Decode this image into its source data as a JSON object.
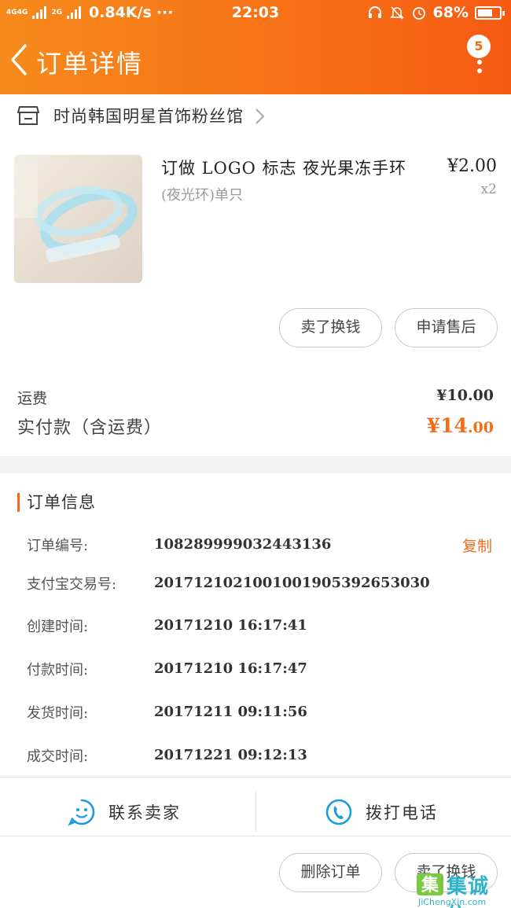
{
  "status_bar": {
    "network_1": "4G",
    "network_2": "4G",
    "network_3": "2G",
    "speed": "0.84K/s",
    "more": "···",
    "time": "22:03",
    "battery": "68%",
    "battery_level": 0.68
  },
  "header": {
    "title": "订单详情",
    "badge_count": "5",
    "accent": "#f77016"
  },
  "shop": {
    "name": "时尚韩国明星首饰粉丝馆"
  },
  "product": {
    "title": "订做 LOGO 标志 夜光果冻手环",
    "spec": "(夜光环)单只",
    "price": "¥2.00",
    "quantity": "x2"
  },
  "item_actions": {
    "sell_label": "卖了换钱",
    "after_sale_label": "申请售后"
  },
  "fees": {
    "shipping_label": "运费",
    "shipping_value": "¥10.00",
    "paid_label": "实付款（含运费）",
    "paid_currency": "¥",
    "paid_int": "14",
    "paid_dec": ".00",
    "highlight_color": "#f36c1a"
  },
  "order_info": {
    "title": "订单信息",
    "copy_label": "复制",
    "rows": [
      {
        "label": "订单编号:",
        "value": "108289999032443136"
      },
      {
        "label": "支付宝交易号:",
        "value": "2017121021001001905392653030"
      },
      {
        "label": "创建时间:",
        "value": "20171210 16:17:41"
      },
      {
        "label": "付款时间:",
        "value": "20171210 16:17:47"
      },
      {
        "label": "发货时间:",
        "value": "20171211 09:11:56"
      },
      {
        "label": "成交时间:",
        "value": "20171221 09:12:13"
      }
    ]
  },
  "contact": {
    "seller_label": "联系卖家",
    "phone_label": "拨打电话"
  },
  "bottom_actions": {
    "delete_label": "删除订单",
    "sell_label": "卖了换钱"
  },
  "watermark": {
    "text": "集诚信",
    "url": "JiChengXin.com"
  }
}
